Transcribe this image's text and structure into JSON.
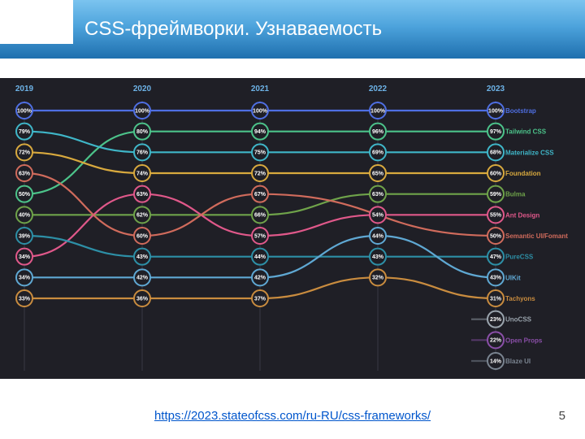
{
  "header": {
    "title": "CSS-фреймворки. Узнаваемость"
  },
  "source": {
    "url": "https://2023.stateofcss.com/ru-RU/css-frameworks/"
  },
  "page": {
    "num": "5"
  },
  "chart_data": {
    "type": "line",
    "title": "",
    "xlabel": "",
    "ylabel": "",
    "categories": [
      "2019",
      "2020",
      "2021",
      "2022",
      "2023"
    ],
    "ylim": [
      0,
      100
    ],
    "series": [
      {
        "name": "Bootstrap",
        "color": "#4f6fe3",
        "values": [
          100,
          100,
          100,
          100,
          100
        ]
      },
      {
        "name": "Tailwind CSS",
        "color": "#4cc38a",
        "values": [
          50,
          80,
          94,
          96,
          97
        ]
      },
      {
        "name": "Materialize CSS",
        "color": "#3fb6c8",
        "values": [
          79,
          76,
          75,
          69,
          68
        ]
      },
      {
        "name": "Foundation",
        "color": "#d8a93e",
        "values": [
          72,
          74,
          72,
          65,
          60
        ]
      },
      {
        "name": "Bulma",
        "color": "#6fa34a",
        "values": [
          40,
          62,
          66,
          63,
          59
        ]
      },
      {
        "name": "Ant Design",
        "color": "#e0588a",
        "values": [
          34,
          63,
          57,
          54,
          55
        ]
      },
      {
        "name": "Semantic UI/Fomant",
        "color": "#d06b5c",
        "values": [
          63,
          60,
          67,
          null,
          50
        ]
      },
      {
        "name": "PureCSS",
        "color": "#2d8fa6",
        "values": [
          39,
          43,
          44,
          43,
          47
        ]
      },
      {
        "name": "UIKit",
        "color": "#5fa8d3",
        "values": [
          34,
          42,
          42,
          44,
          43
        ]
      },
      {
        "name": "Tachyons",
        "color": "#c98c3f",
        "values": [
          33,
          36,
          37,
          32,
          31
        ]
      },
      {
        "name": "UnoCSS",
        "color": "#9aa4ad",
        "values": [
          null,
          null,
          null,
          null,
          23
        ]
      },
      {
        "name": "Open Props",
        "color": "#8a4fa8",
        "values": [
          null,
          null,
          null,
          null,
          22
        ]
      },
      {
        "name": "Blaze UI",
        "color": "#7a8490",
        "values": [
          null,
          null,
          null,
          null,
          14
        ]
      }
    ]
  }
}
